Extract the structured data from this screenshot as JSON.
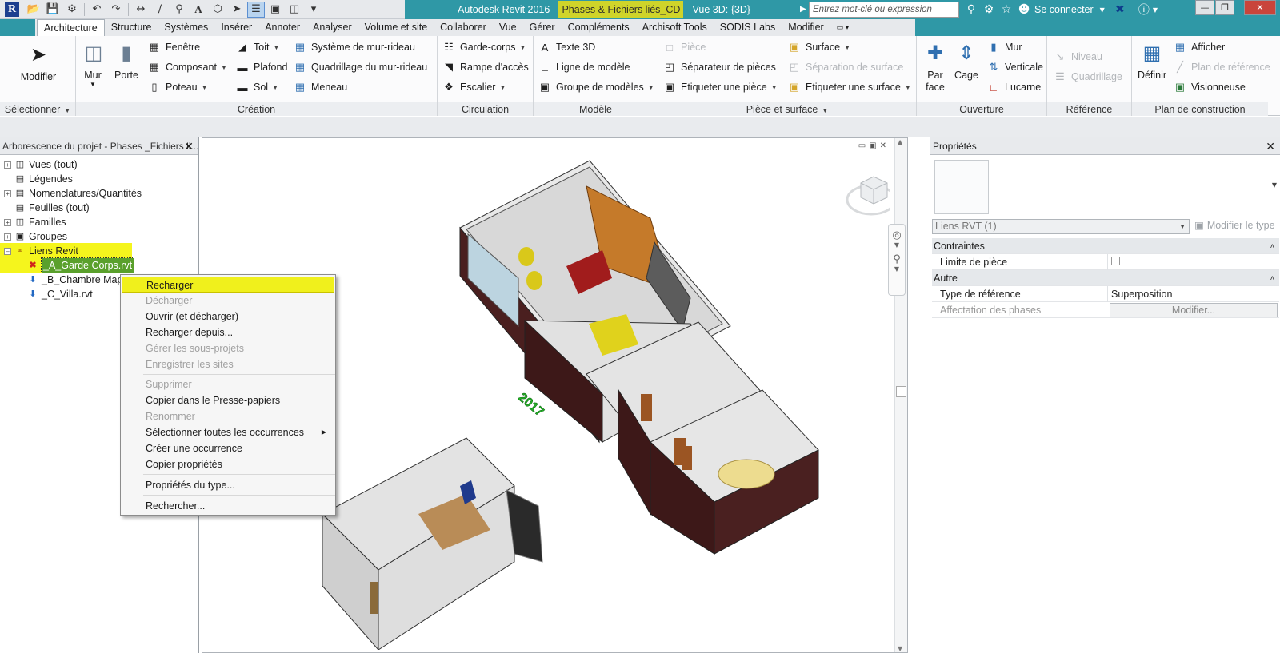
{
  "window": {
    "title_prefix": "Autodesk Revit 2016 - ",
    "title_file": "Phases & Fichiers liés_CD",
    "title_suffix": " - Vue 3D: {3D}",
    "search_placeholder": "Entrez mot-clé ou expression",
    "connect_label": "Se connecter"
  },
  "tabs": [
    "Architecture",
    "Structure",
    "Systèmes",
    "Insérer",
    "Annoter",
    "Analyser",
    "Volume et site",
    "Collaborer",
    "Vue",
    "Gérer",
    "Compléments",
    "Archisoft Tools",
    "SODIS Labs",
    "Modifier"
  ],
  "ribbon": {
    "select": {
      "modify": "Modifier",
      "title": "Sélectionner"
    },
    "creation": {
      "title": "Création",
      "wall": "Mur",
      "door": "Porte",
      "window": "Fenêtre",
      "component": "Composant",
      "column": "Poteau",
      "roof": "Toit",
      "ceiling": "Plafond",
      "floor": "Sol",
      "curtain_system": "Système de mur-rideau",
      "curtain_grid": "Quadrillage du mur-rideau",
      "mullion": "Meneau"
    },
    "circulation": {
      "title": "Circulation",
      "railing": "Garde-corps",
      "ramp": "Rampe d'accès",
      "stair": "Escalier"
    },
    "model": {
      "title": "Modèle",
      "text3d": "Texte 3D",
      "model_line": "Ligne de modèle",
      "model_group": "Groupe de modèles"
    },
    "room_area": {
      "title": "Pièce et surface",
      "room": "Pièce",
      "room_separator": "Séparateur de pièces",
      "tag_room": "Etiqueter une pièce",
      "area": "Surface",
      "area_boundary": "Séparation de surface",
      "tag_area": "Etiqueter une surface"
    },
    "opening": {
      "title": "Ouverture",
      "by_face": "Par face",
      "shaft": "Cage",
      "wall": "Mur",
      "vertical": "Verticale",
      "dormer": "Lucarne"
    },
    "datum": {
      "title": "Référence",
      "level": "Niveau",
      "grid": "Quadrillage"
    },
    "work_plane": {
      "title": "Plan de construction",
      "set": "Définir",
      "show": "Afficher",
      "ref_plane": "Plan de référence",
      "viewer": "Visionneuse"
    }
  },
  "project_browser": {
    "title": "Arborescence du projet - Phases _Fichiers li...",
    "items": [
      {
        "label": "Vues (tout)",
        "icon": "views-icon"
      },
      {
        "label": "Légendes",
        "icon": "legend-icon"
      },
      {
        "label": "Nomenclatures/Quantités",
        "icon": "schedule-icon"
      },
      {
        "label": "Feuilles (tout)",
        "icon": "sheet-icon"
      },
      {
        "label": "Familles",
        "icon": "family-icon"
      },
      {
        "label": "Groupes",
        "icon": "group-icon"
      },
      {
        "label": "Liens Revit",
        "icon": "link-icon"
      }
    ],
    "links": [
      "_A_Garde Corps.rvt",
      "_B_Chambre Map",
      "_C_Villa.rvt"
    ]
  },
  "context_menu": {
    "items": [
      {
        "label": "Recharger",
        "state": "hover"
      },
      {
        "label": "Décharger",
        "state": "disabled"
      },
      {
        "label": "Ouvrir (et décharger)",
        "state": "enabled"
      },
      {
        "label": "Recharger depuis...",
        "state": "enabled"
      },
      {
        "label": "Gérer les sous-projets",
        "state": "disabled"
      },
      {
        "label": "Enregistrer les sites",
        "state": "disabled"
      },
      {
        "label": "Supprimer",
        "state": "disabled"
      },
      {
        "label": "Copier dans le Presse-papiers",
        "state": "enabled"
      },
      {
        "label": "Renommer",
        "state": "disabled"
      },
      {
        "label": "Sélectionner toutes les occurrences",
        "state": "submenu"
      },
      {
        "label": "Créer une occurrence",
        "state": "enabled"
      },
      {
        "label": "Copier propriétés",
        "state": "enabled"
      },
      {
        "label": "Propriétés du type...",
        "state": "enabled"
      },
      {
        "label": "Rechercher...",
        "state": "enabled"
      }
    ]
  },
  "viewport": {
    "model_label": "2017"
  },
  "properties": {
    "title": "Propriétés",
    "type_selector": "Liens RVT (1)",
    "edit_type": "Modifier le type",
    "groups": [
      {
        "name": "Contraintes",
        "rows": [
          {
            "name": "Limite de pièce",
            "value": ""
          }
        ]
      },
      {
        "name": "Autre",
        "rows": [
          {
            "name": "Type de référence",
            "value": "Superposition"
          },
          {
            "name": "Affectation des phases",
            "value": "Modifier..."
          }
        ]
      }
    ]
  },
  "colors": {
    "title_teal": "#2f98a6",
    "highlight_yellow": "#f5f51d",
    "selection_green": "#5aa02c"
  }
}
